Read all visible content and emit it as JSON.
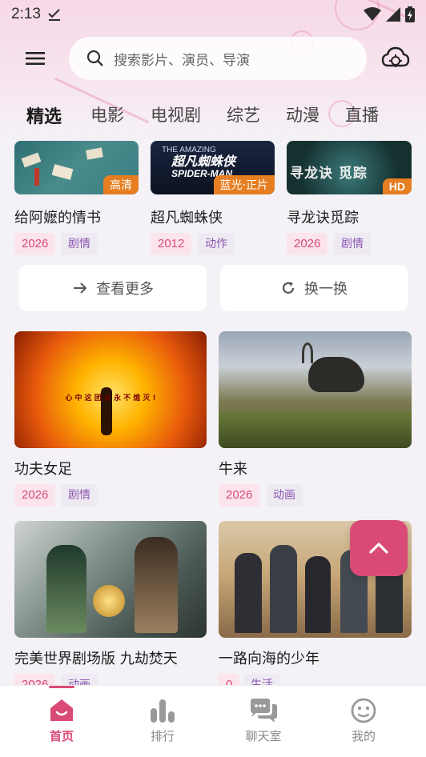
{
  "status": {
    "time": "2:13"
  },
  "search": {
    "placeholder": "搜索影片、演员、导演"
  },
  "tabs": [
    {
      "label": "精选",
      "active": true
    },
    {
      "label": "电影"
    },
    {
      "label": "电视剧"
    },
    {
      "label": "综艺"
    },
    {
      "label": "动漫"
    },
    {
      "label": "直播"
    }
  ],
  "row_top": [
    {
      "title": "给阿嬷的情书",
      "badge": "高清",
      "year": "2026",
      "genre": "剧情"
    },
    {
      "title": "超凡蜘蛛侠",
      "badge": "蓝光·正片",
      "year": "2012",
      "genre": "动作"
    },
    {
      "title": "寻龙诀觅踪",
      "badge": "HD",
      "year": "2026",
      "genre": "剧情"
    }
  ],
  "thumb_text": {
    "spider_cn": "超凡蜘蛛侠",
    "spider_en": "SPIDER-MAN",
    "spider_sub": "THE AMAZING",
    "dragon_cn": "寻龙诀 觅踪",
    "kungfu_slogan": "心 中 这 团 火 永 不 熄 灭 !"
  },
  "actions": {
    "more": "查看更多",
    "refresh": "换一换"
  },
  "grid": [
    {
      "title": "功夫女足",
      "year": "2026",
      "genre": "剧情"
    },
    {
      "title": "牛来",
      "year": "2026",
      "genre": "动画"
    },
    {
      "title": "完美世界剧场版 九劫焚天",
      "year": "2026",
      "genre": "动画"
    },
    {
      "title": "一路向海的少年",
      "year": "0",
      "genre": "生活"
    }
  ],
  "nav": [
    {
      "label": "首页",
      "active": true
    },
    {
      "label": "排行"
    },
    {
      "label": "聊天室"
    },
    {
      "label": "我的"
    }
  ],
  "colors": {
    "accent": "#d94b76",
    "badge": "#e67e22",
    "tag_year_bg": "#fbe4ec",
    "tag_genre_bg": "#eeeaf2"
  }
}
